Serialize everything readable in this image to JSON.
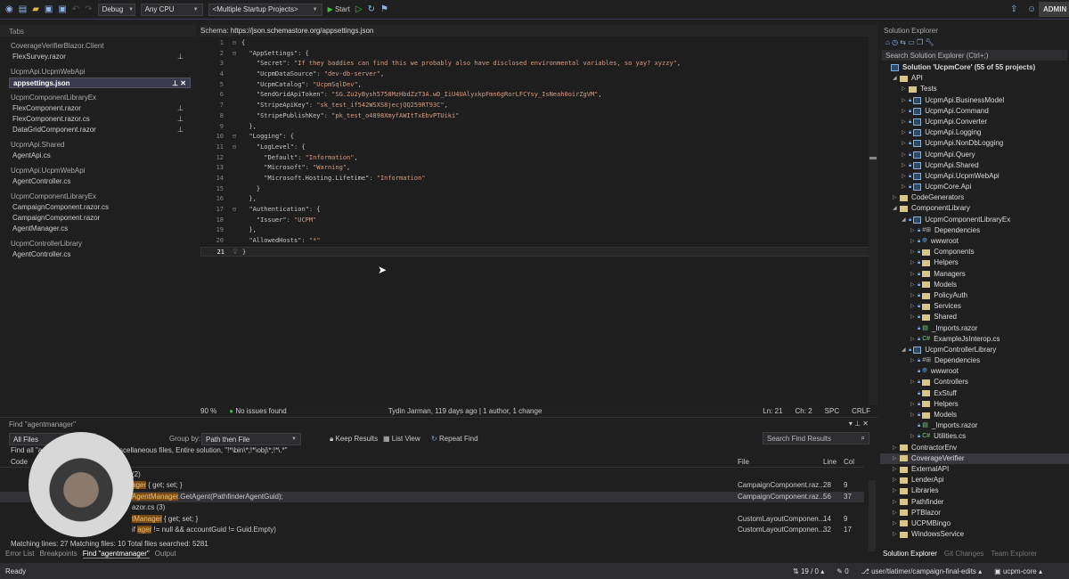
{
  "toolbar": {
    "config": "Debug",
    "platform": "Any CPU",
    "startup": "<Multiple Startup Projects>",
    "start_label": "Start",
    "account": "ADMIN"
  },
  "tabs_panel": {
    "title": "Tabs",
    "groups": [
      {
        "name": "CoverageVerifierBlazor.Client",
        "items": [
          {
            "label": "FlexSurvey.razor",
            "pinned": true
          }
        ]
      },
      {
        "name": "UcpmApi.UcpmWebApi",
        "items": [
          {
            "label": "appsettings.json",
            "pinned": true,
            "active": true
          }
        ]
      },
      {
        "name": "UcpmComponentLibraryEx",
        "items": [
          {
            "label": "FlexComponent.razor",
            "pinned": true
          },
          {
            "label": "FlexComponent.razor.cs",
            "pinned": true
          },
          {
            "label": "DataGridComponent.razor",
            "pinned": true
          }
        ]
      },
      {
        "name": "UcpmApi.Shared",
        "items": [
          {
            "label": "AgentApi.cs"
          }
        ]
      },
      {
        "name": "UcpmApi.UcpmWebApi",
        "items": [
          {
            "label": "AgentController.cs"
          }
        ]
      },
      {
        "name": "UcpmComponentLibraryEx",
        "items": [
          {
            "label": "CampaignComponent.razor.cs"
          },
          {
            "label": "CampaignComponent.razor"
          },
          {
            "label": "AgentManager.cs"
          }
        ]
      },
      {
        "name": "UcpmControllerLibrary",
        "items": [
          {
            "label": "AgentController.cs"
          }
        ]
      }
    ]
  },
  "editor": {
    "schema_label": "Schema:",
    "schema_url": "https://json.schemastore.org/appsettings.json",
    "lines": [
      "{",
      "  \"AppSettings\": {",
      "    \"Secret\": \"If they baddies can find this we probably also have disclosed environmental variables, so yay? xyzzy\",",
      "    \"UcpmDataSource\": \"dev-db-server\",",
      "    \"UcpmCatalog\": \"UcpmSqlDev\",",
      "    \"SendGridApiToken\": \"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\",",
      "    \"StripeApiKey\": \"sk_test_if542WSXS8jecjQQ259RT93C\",",
      "    \"StripePublishKey\": \"pk_test_o4898XmyfAWItTxEbvPTUiki\"",
      "  },",
      "  \"Logging\": {",
      "    \"LogLevel\": {",
      "      \"Default\": \"Information\",",
      "      \"Microsoft\": \"Warning\",",
      "      \"Microsoft.Hosting.Lifetime\": \"Information\"",
      "    }",
      "  },",
      "  \"Authentication\": {",
      "    \"Issuer\": \"UCPM\"",
      "  },",
      "  \"AllowedHosts\": \"*\"",
      "}"
    ],
    "status": {
      "zoom": "90 %",
      "issues": "No issues found",
      "blame": "Tydin Jarman, 119 days ago | 1 author, 1 change",
      "ln": "Ln: 21",
      "ch": "Ch: 2",
      "spc": "SPC",
      "crlf": "CRLF"
    }
  },
  "find": {
    "title": "Find \"agentmanager\"",
    "scope": "All Files",
    "group_by_label": "Group by:",
    "group_by": "Path then File",
    "keep_results": "Keep Results",
    "list_view": "List View",
    "repeat_find": "Repeat Find",
    "search_placeholder": "Search Find Results",
    "description": "Find all \"a... ...ole word, Include miscellaneous files, Entire solution, \"!*\\bin\\*;!*\\obj\\*;!*\\.*\"",
    "columns": {
      "code": "Code",
      "file": "File",
      "line": "Line",
      "col": "Col"
    },
    "rows": [
      {
        "pre": "",
        "match": "",
        "post": "(2)",
        "file": "",
        "line": "",
        "col": ""
      },
      {
        "pre": "",
        "match": "ager",
        "post": " { get; set; }",
        "file": "CampaignComponent.raz...",
        "line": "28",
        "col": "9"
      },
      {
        "pre": "",
        "match": "AgentManager",
        "post": ".GetAgent(PathfinderAgentGuid);",
        "file": "CampaignComponent.raz...",
        "line": "56",
        "col": "37",
        "selected": true
      },
      {
        "pre": "",
        "match": "",
        "post": "azor.cs (3)",
        "file": "",
        "line": "",
        "col": ""
      },
      {
        "pre": "",
        "match": "tManager",
        "post": " { get; set; }",
        "file": "CustomLayoutComponen...",
        "line": "14",
        "col": "9"
      },
      {
        "pre": "if ",
        "match": "ager",
        "post": " != null && accountGuid != Guid.Empty)",
        "file": "CustomLayoutComponen...",
        "line": "32",
        "col": "17"
      }
    ],
    "summary": "Matching lines: 27 Matching files: 10 Total files searched: 5281",
    "bottom_tabs": [
      "Error List",
      "Breakpoints",
      "Find \"agentmanager\"",
      "Output"
    ]
  },
  "solution_explorer": {
    "title": "Solution Explorer",
    "search_placeholder": "Search Solution Explorer (Ctrl+;)",
    "tree": [
      {
        "d": 0,
        "t": "sln",
        "label": "Solution 'UcpmCore' (55 of 55 projects)",
        "x": ""
      },
      {
        "d": 1,
        "t": "folder",
        "label": "API",
        "x": "open"
      },
      {
        "d": 2,
        "t": "folder",
        "label": "Tests",
        "x": "closed"
      },
      {
        "d": 2,
        "t": "proj",
        "label": "UcpmApi.BusinessModel",
        "x": "closed"
      },
      {
        "d": 2,
        "t": "proj",
        "label": "UcpmApi.Command",
        "x": "closed"
      },
      {
        "d": 2,
        "t": "proj",
        "label": "UcpmApi.Converter",
        "x": "closed"
      },
      {
        "d": 2,
        "t": "proj",
        "label": "UcpmApi.Logging",
        "x": "closed"
      },
      {
        "d": 2,
        "t": "proj",
        "label": "UcpmApi.NonDbLogging",
        "x": "closed"
      },
      {
        "d": 2,
        "t": "proj",
        "label": "UcpmApi.Query",
        "x": "closed"
      },
      {
        "d": 2,
        "t": "proj",
        "label": "UcpmApi.Shared",
        "x": "closed"
      },
      {
        "d": 2,
        "t": "proj",
        "label": "UcpmApi.UcpmWebApi",
        "x": "closed"
      },
      {
        "d": 2,
        "t": "proj",
        "label": "UcpmCore.Api",
        "x": "closed"
      },
      {
        "d": 1,
        "t": "folder",
        "label": "CodeGenerators",
        "x": "closed"
      },
      {
        "d": 1,
        "t": "folder",
        "label": "ComponentLibrary",
        "x": "open"
      },
      {
        "d": 2,
        "t": "proj",
        "label": "UcpmComponentLibraryEx",
        "x": "open"
      },
      {
        "d": 3,
        "t": "dep",
        "label": "Dependencies",
        "x": "closed"
      },
      {
        "d": 3,
        "t": "web",
        "label": "wwwroot",
        "x": "closed"
      },
      {
        "d": 3,
        "t": "folder",
        "label": "Components",
        "x": "closed"
      },
      {
        "d": 3,
        "t": "folder",
        "label": "Helpers",
        "x": "closed"
      },
      {
        "d": 3,
        "t": "folder",
        "label": "Managers",
        "x": "closed"
      },
      {
        "d": 3,
        "t": "folder",
        "label": "Models",
        "x": "closed"
      },
      {
        "d": 3,
        "t": "folder",
        "label": "PolicyAuth",
        "x": "closed"
      },
      {
        "d": 3,
        "t": "folder",
        "label": "Services",
        "x": "closed"
      },
      {
        "d": 3,
        "t": "folder",
        "label": "Shared",
        "x": "closed"
      },
      {
        "d": 3,
        "t": "file",
        "label": "_Imports.razor",
        "x": ""
      },
      {
        "d": 3,
        "t": "cs",
        "label": "ExampleJsInterop.cs",
        "x": "closed"
      },
      {
        "d": 2,
        "t": "proj",
        "label": "UcpmControllerLibrary",
        "x": "open"
      },
      {
        "d": 3,
        "t": "dep",
        "label": "Dependencies",
        "x": "closed"
      },
      {
        "d": 3,
        "t": "web",
        "label": "wwwroot",
        "x": ""
      },
      {
        "d": 3,
        "t": "folder",
        "label": "Controllers",
        "x": "closed"
      },
      {
        "d": 3,
        "t": "folder",
        "label": "ExStuff",
        "x": ""
      },
      {
        "d": 3,
        "t": "folder",
        "label": "Helpers",
        "x": "closed"
      },
      {
        "d": 3,
        "t": "folder",
        "label": "Models",
        "x": "closed"
      },
      {
        "d": 3,
        "t": "file",
        "label": "_Imports.razor",
        "x": ""
      },
      {
        "d": 3,
        "t": "cs",
        "label": "Utilities.cs",
        "x": "closed"
      },
      {
        "d": 1,
        "t": "folder",
        "label": "ContractorEnv",
        "x": "closed"
      },
      {
        "d": 1,
        "t": "folder",
        "label": "CoverageVerifier",
        "x": "closed",
        "selected": true
      },
      {
        "d": 1,
        "t": "folder",
        "label": "ExternalAPI",
        "x": "closed"
      },
      {
        "d": 1,
        "t": "folder",
        "label": "LenderApi",
        "x": "closed"
      },
      {
        "d": 1,
        "t": "folder",
        "label": "Libraries",
        "x": "closed"
      },
      {
        "d": 1,
        "t": "folder",
        "label": "Pathfinder",
        "x": "closed"
      },
      {
        "d": 1,
        "t": "folder",
        "label": "PTBlazor",
        "x": "closed"
      },
      {
        "d": 1,
        "t": "folder",
        "label": "UCPMBingo",
        "x": "closed"
      },
      {
        "d": 1,
        "t": "folder",
        "label": "WindowsService",
        "x": "closed"
      }
    ],
    "bottom_tabs": [
      "Solution Explorer",
      "Git Changes",
      "Team Explorer"
    ]
  },
  "statusbar": {
    "ready": "Ready",
    "counts": "19 / 0",
    "edits": "0",
    "branch": "user/tlatimer/campaign-final-edits",
    "repo": "ucpm-core"
  }
}
